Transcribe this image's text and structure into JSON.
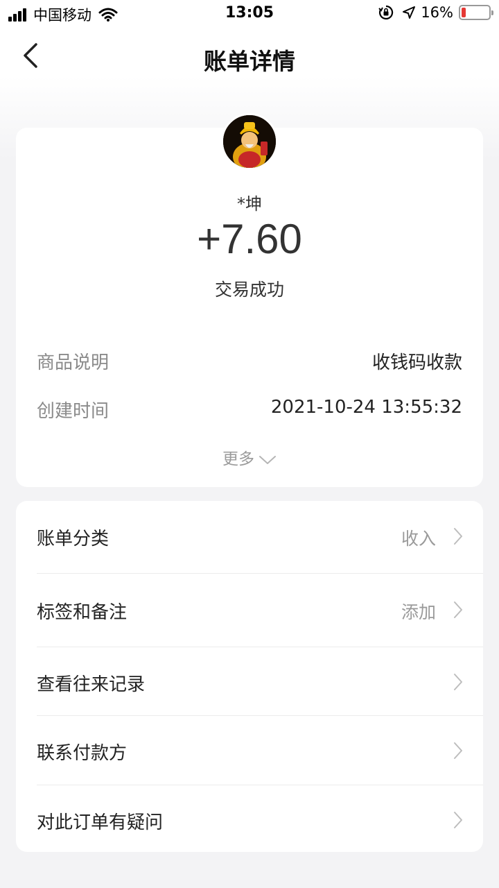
{
  "status_bar": {
    "carrier": "中国移动",
    "time": "13:05",
    "battery_pct": "16%",
    "battery_level": 0.16,
    "battery_color": "#e53935",
    "icons": [
      "signal-icon",
      "wifi-icon",
      "orientation-lock-icon",
      "location-icon",
      "battery-icon"
    ]
  },
  "nav": {
    "title": "账单详情",
    "back_icon": "chevron-left-icon"
  },
  "summary": {
    "payer_name": "*坤",
    "amount": "+7.60",
    "status": "交易成功",
    "details": [
      {
        "key": "商品说明",
        "value": "收钱码收款"
      },
      {
        "key": "创建时间",
        "value": "2021-10-24 13:55:32"
      }
    ],
    "more_label": "更多"
  },
  "actions": [
    {
      "label": "账单分类",
      "value": "收入"
    },
    {
      "label": "标签和备注",
      "value": "添加"
    },
    {
      "label": "查看往来记录",
      "value": ""
    },
    {
      "label": "联系付款方",
      "value": ""
    },
    {
      "label": "对此订单有疑问",
      "value": ""
    }
  ]
}
